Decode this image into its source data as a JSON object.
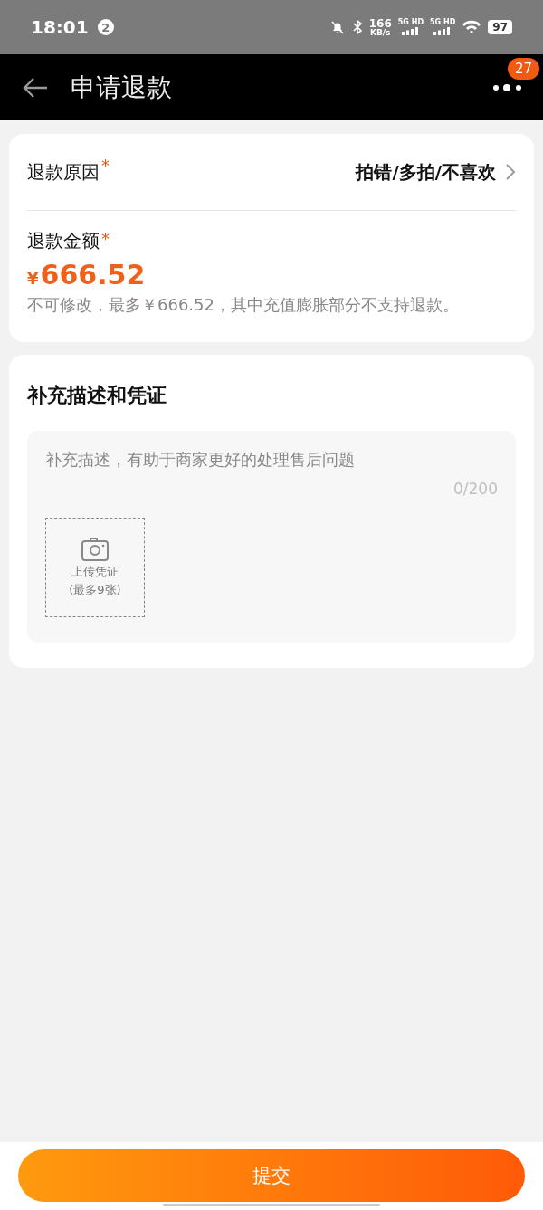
{
  "status_bar": {
    "time": "18:01",
    "notification_count": "2",
    "net_speed": "166",
    "net_unit": "KB/s",
    "sim": [
      "5G HD",
      "5G HD"
    ],
    "battery": "97"
  },
  "header": {
    "title": "申请退款",
    "badge": "27"
  },
  "refund_card": {
    "reason": {
      "label": "退款原因",
      "required_mark": "*",
      "value": "拍错/多拍/不喜欢"
    },
    "amount": {
      "label": "退款金额",
      "required_mark": "*",
      "currency": "¥",
      "value": "666.52",
      "note": "不可修改，最多￥666.52，其中充值膨胀部分不支持退款。"
    }
  },
  "evidence_card": {
    "title": "补充描述和凭证",
    "placeholder": "补充描述，有助于商家更好的处理售后问题",
    "counter": "0/200",
    "upload": {
      "label": "上传凭证",
      "hint": "(最多9张)"
    }
  },
  "submit": {
    "label": "提交"
  }
}
